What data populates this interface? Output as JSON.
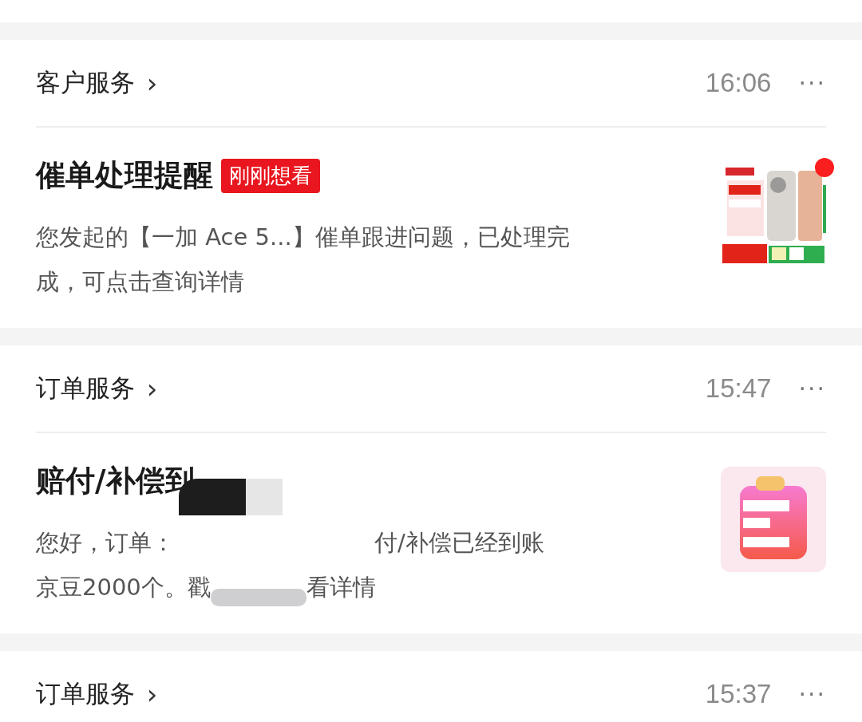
{
  "messages": [
    {
      "kind": "product",
      "section": "客户服务",
      "chevron": "›",
      "time": "16:06",
      "more": "···",
      "title": "催单处理提醒",
      "badge": "刚刚想看",
      "unread": true,
      "body_lines": [
        [
          "您发起的【一加 Ace 5...】催单跟进问题，已处理完"
        ],
        [
          "成，可点击查询详情"
        ]
      ]
    },
    {
      "kind": "clipboard",
      "section": "订单服务",
      "chevron": "›",
      "time": "15:47",
      "more": "···",
      "title": "赔付/补偿到",
      "redacted": true,
      "unread": false,
      "body_lines": [
        [
          "您好，订单：",
          "付/补偿已经到账"
        ],
        [
          "京豆2000个。戳",
          "看详情"
        ]
      ]
    },
    {
      "kind": "none",
      "section": "订单服务",
      "chevron": "›",
      "time": "15:37",
      "more": "···"
    }
  ]
}
